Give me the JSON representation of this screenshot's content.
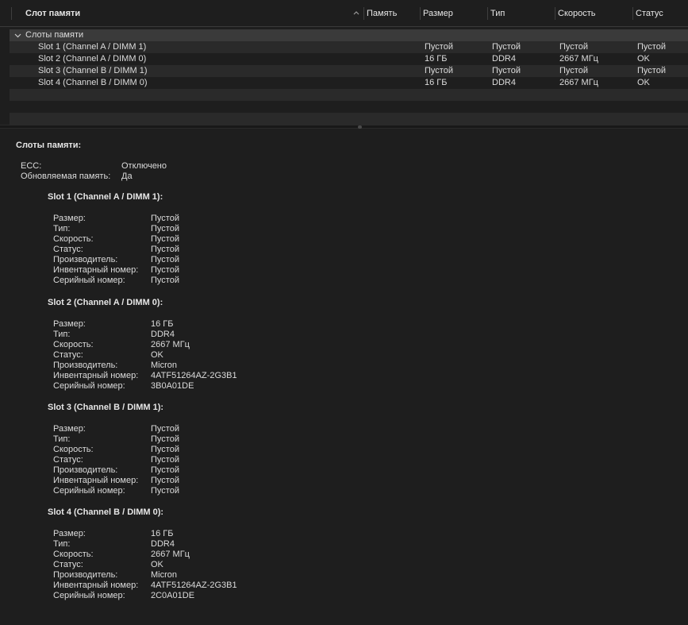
{
  "table": {
    "columns": [
      "Слот памяти",
      "Память",
      "Размер",
      "Тип",
      "Скорость",
      "Статус"
    ],
    "group": {
      "label": "Слоты памяти"
    },
    "rows": [
      {
        "slot": "Slot 1 (Channel A / DIMM 1)",
        "size": "Пустой",
        "type": "Пустой",
        "speed": "Пустой",
        "status": "Пустой"
      },
      {
        "slot": "Slot 2 (Channel A / DIMM 0)",
        "size": "16 ГБ",
        "type": "DDR4",
        "speed": "2667 МГц",
        "status": "OK"
      },
      {
        "slot": "Slot 3 (Channel B / DIMM 1)",
        "size": "Пустой",
        "type": "Пустой",
        "speed": "Пустой",
        "status": "Пустой"
      },
      {
        "slot": "Slot 4 (Channel B / DIMM 0)",
        "size": "16 ГБ",
        "type": "DDR4",
        "speed": "2667 МГц",
        "status": "OK"
      }
    ]
  },
  "detail": {
    "title": "Слоты памяти:",
    "ecc_label": "ECC:",
    "ecc_value": "Отключено",
    "upgradable_label": "Обновляемая память:",
    "upgradable_value": "Да",
    "field_labels": {
      "size": "Размер:",
      "type": "Тип:",
      "speed": "Скорость:",
      "status": "Статус:",
      "manufacturer": "Производитель:",
      "part": "Инвентарный номер:",
      "serial": "Серийный номер:"
    },
    "slots": [
      {
        "title": "Slot 1 (Channel A / DIMM 1):",
        "size": "Пустой",
        "type": "Пустой",
        "speed": "Пустой",
        "status": "Пустой",
        "manufacturer": "Пустой",
        "part": "Пустой",
        "serial": "Пустой"
      },
      {
        "title": "Slot 2 (Channel A / DIMM 0):",
        "size": "16 ГБ",
        "type": "DDR4",
        "speed": "2667 МГц",
        "status": "OK",
        "manufacturer": "Micron",
        "part": "4ATF51264AZ-2G3B1",
        "serial": "3B0A01DE"
      },
      {
        "title": "Slot 3 (Channel B / DIMM 1):",
        "size": "Пустой",
        "type": "Пустой",
        "speed": "Пустой",
        "status": "Пустой",
        "manufacturer": "Пустой",
        "part": "Пустой",
        "serial": "Пустой"
      },
      {
        "title": "Slot 4 (Channel B / DIMM 0):",
        "size": "16 ГБ",
        "type": "DDR4",
        "speed": "2667 МГц",
        "status": "OK",
        "manufacturer": "Micron",
        "part": "4ATF51264AZ-2G3B1",
        "serial": "2C0A01DE"
      }
    ]
  }
}
